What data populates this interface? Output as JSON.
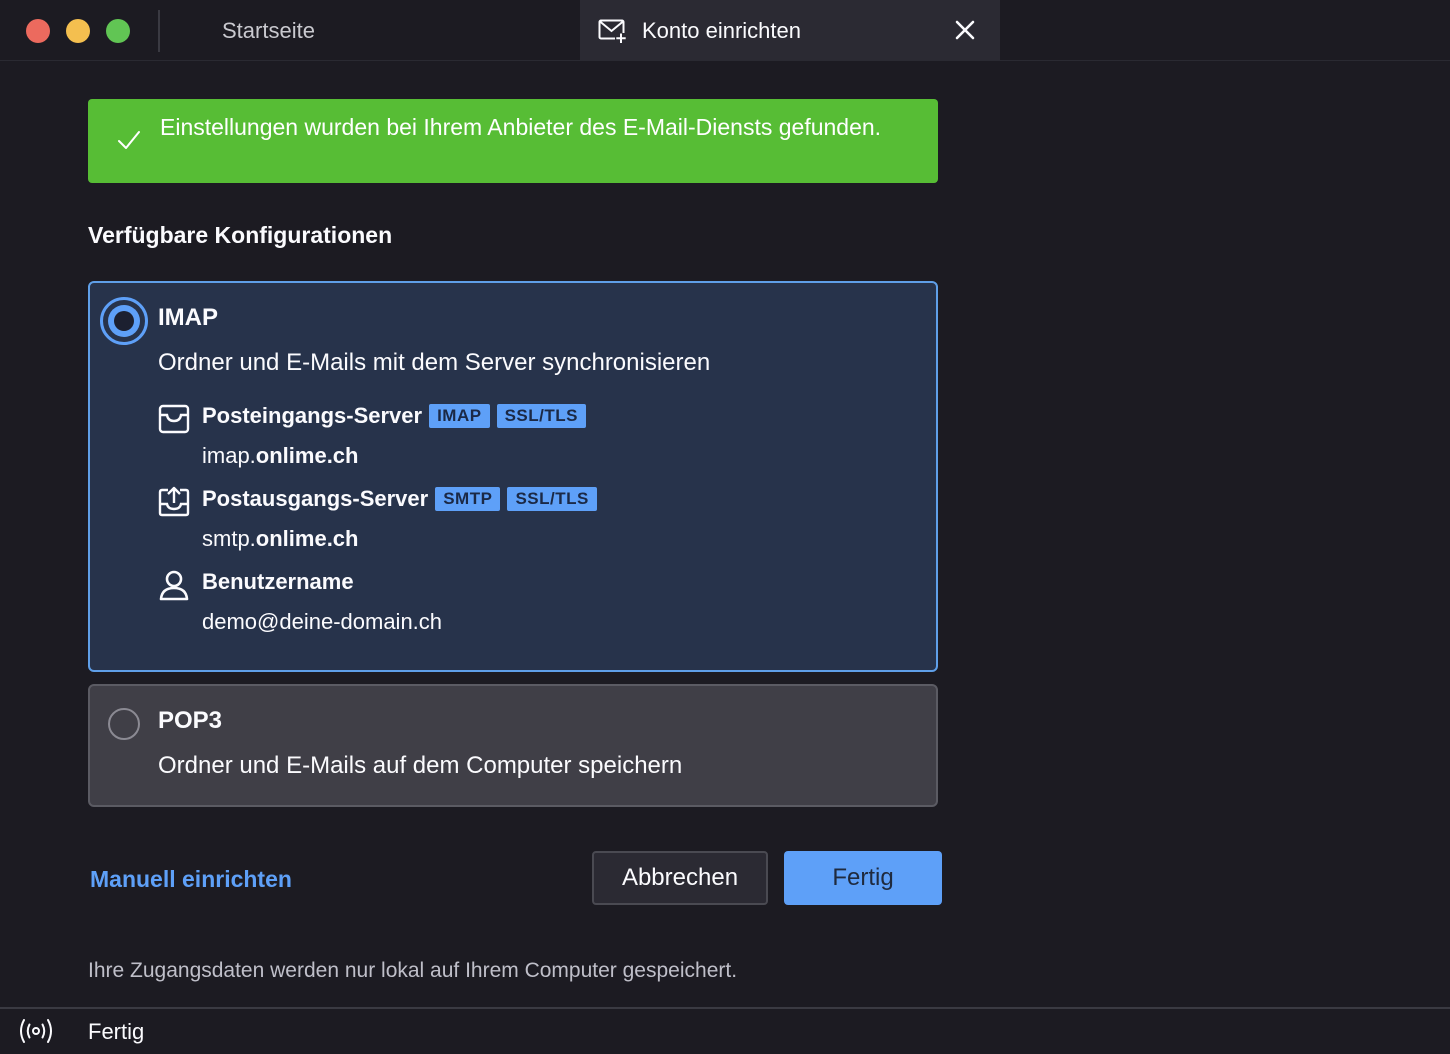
{
  "window": {
    "tabs": [
      {
        "label": "Startseite",
        "active": false
      },
      {
        "label": "Konto einrichten",
        "active": true,
        "icon": "mail-add-icon"
      }
    ]
  },
  "banner": {
    "icon": "check-icon",
    "text": "Einstellungen wurden bei Ihrem Anbieter des E-Mail-Diensts gefunden.",
    "color": "#57bd35"
  },
  "section_title": "Verfügbare Konfigurationen",
  "configs": {
    "imap": {
      "selected": true,
      "title": "IMAP",
      "description": "Ordner und E-Mails mit dem Server synchronisieren",
      "incoming": {
        "label": "Posteingangs-Server",
        "badges": [
          "IMAP",
          "SSL/TLS"
        ],
        "host_prefix": "imap.",
        "host_domain": "onlime.ch",
        "icon": "inbox-icon"
      },
      "outgoing": {
        "label": "Postausgangs-Server",
        "badges": [
          "SMTP",
          "SSL/TLS"
        ],
        "host_prefix": "smtp.",
        "host_domain": "onlime.ch",
        "icon": "outbox-icon"
      },
      "username": {
        "label": "Benutzername",
        "value": "demo@deine-domain.ch",
        "icon": "user-icon"
      }
    },
    "pop3": {
      "selected": false,
      "title": "POP3",
      "description": "Ordner und E-Mails auf dem Computer speichern"
    }
  },
  "actions": {
    "manual_setup": "Manuell einrichten",
    "cancel": "Abbrechen",
    "done": "Fertig"
  },
  "footer_note": "Ihre Zugangsdaten werden nur lokal auf Ihrem Computer gespeichert.",
  "statusbar": {
    "icon": "broadcast-icon",
    "text": "Fertig"
  },
  "colors": {
    "accent": "#5ea0f8",
    "success": "#57bd35",
    "background": "#1c1b22",
    "selected_card": "#27334b"
  }
}
